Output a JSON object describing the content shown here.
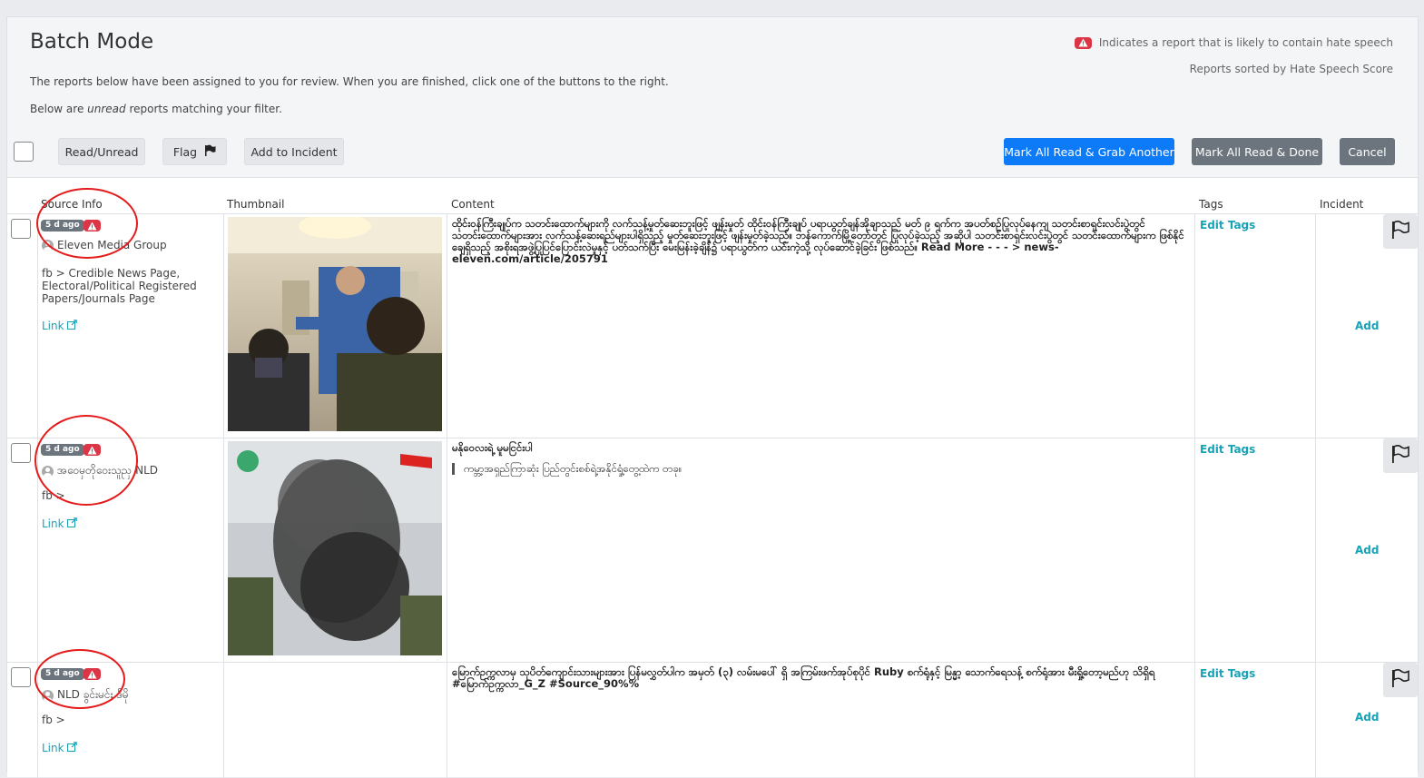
{
  "header": {
    "title": "Batch Mode",
    "description": "The reports below have been assigned to you for review. When you are finished, click one of the buttons to the right.",
    "filter_prefix": "Below are ",
    "filter_emph": "unread",
    "filter_suffix": " reports matching your filter.",
    "legend_text": "Indicates a report that is likely to contain hate speech",
    "sort_note": "Reports sorted by Hate Speech Score"
  },
  "toolbar": {
    "read_unread": "Read/Unread",
    "flag": "Flag",
    "add_to_incident": "Add to Incident",
    "mark_grab": "Mark All Read & Grab Another",
    "mark_done": "Mark All Read & Done",
    "cancel": "Cancel"
  },
  "columns": {
    "source_info": "Source Info",
    "thumbnail": "Thumbnail",
    "content": "Content",
    "tags": "Tags",
    "incident": "Incident"
  },
  "rows": [
    {
      "age": "5 d ago",
      "source": "Eleven Media Group",
      "category": "fb > Credible News Page, Electoral/Political Registered Papers/Journals Page",
      "link": "Link",
      "content": "ထိုင်းဝန်ကြီးချုပ်က သတင်းထောက်များကို လက်သန့်မှုတ်ဆေးဘူးဖြင့် ဖျန်းမှုတ် ထိုင်းဝန်ကြီးချုပ် ပရာယွတ်ချန်အိုချာသည် မတ် ၉ ရက်က အပတ်စဉ်ပြုလုပ်နေကျ သတင်းစာရှင်းလင်းပွဲတွင် သတင်းထောက်များအား လက်သန့်ဆေးရည်များပါရှိသည့် မှုတ်ဆေးဘူးဖြင့် ဖျန်းမှုတ်ခဲ့သည်။ ဘန်ကောက်မြို့တော်တွင် ပြုလုပ်ခဲ့သည့် အဆိုပါ သတင်းစာရှင်းလင်းပွဲတွင် သတင်းထောက်များက ဖြစ်နိုင်ချေရှိသည့် အစိုးရအဖွဲ့ပြုပြင်ပြောင်းလဲမှုနှင့် ပတ်သက်ပြီး မေးမြန်းခဲ့ချိန်၌ ပရာယွတ်က ယင်းကဲ့သို့ လုပ်ဆောင်ခဲ့ခြင်း ဖြစ်သည်။ Read More - - - > news-eleven.com/article/205791",
      "quote": "",
      "edit_tags": "Edit Tags",
      "add": "Add"
    },
    {
      "age": "5 d ago",
      "source": "အဝေမှတိုဝေးသူညှ NLD",
      "category": "fb >",
      "link": "Link",
      "content": "မနိုဝေလးရဲ့ မူမငြင်းပါ",
      "quote": "ကမ္ဘာ့အရှည်ကြာဆုံး ပြည်တွင်းစစ်ရဲ့အနိုင်ရှုံ့တွေ့ထဲက တခု။",
      "edit_tags": "Edit Tags",
      "add": "Add"
    },
    {
      "age": "5 d ago",
      "source": "NLD ခွင်းမင်း ဒီမို",
      "category": "fb >",
      "link": "Link",
      "content": "မြောက်ဥက္ကလာမှ သုပိတ်ကျောင်းသားများအား ပြန်မလွှတ်ပါက အမှတ် (၃) လမ်းမပေါ် ရှိ အကြမ်းဖက်အုပ်စုပိုင် Ruby စက်ရုံနှင့် မြန္မာ့ သောက်ရေသန့် စက်ရုံအား မီးရှို့တော့မည်ဟု သိရှိရ #မြောက်ဥက္ကလာ_G_Z #Source_90%%",
      "quote": "",
      "edit_tags": "Edit Tags",
      "add": "Add"
    }
  ],
  "colors": {
    "accent_blue": "#0d7bf7",
    "link_teal": "#17a2b8",
    "danger": "#dc3545",
    "annotation_red": "#e31b1b"
  }
}
